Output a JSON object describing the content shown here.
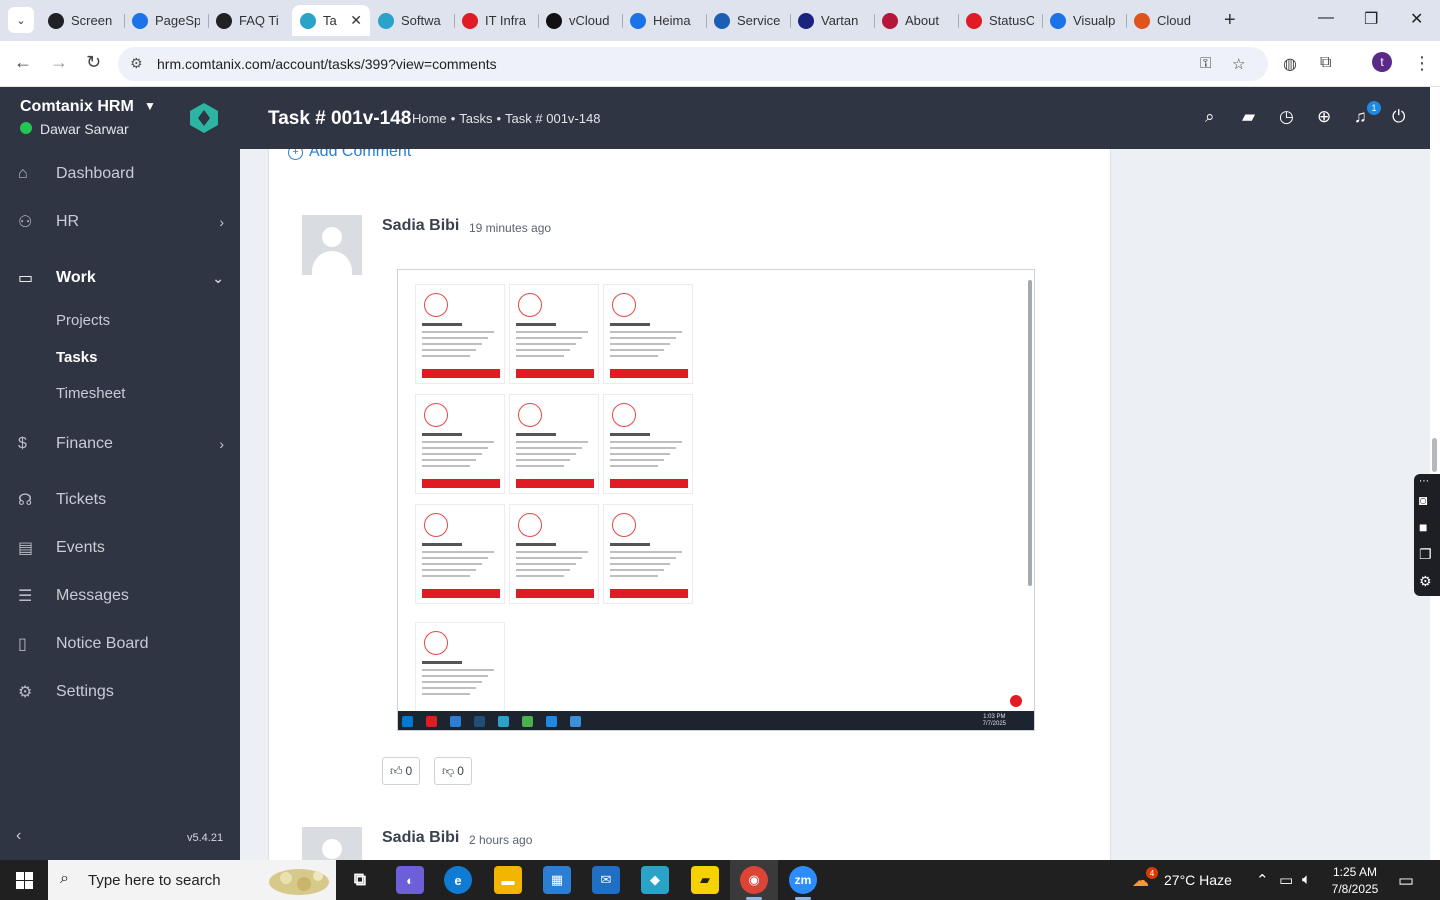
{
  "browser": {
    "tabs": [
      {
        "label": "Screen",
        "icon": "screen-recorder-icon",
        "color": "#202124"
      },
      {
        "label": "PageSp",
        "icon": "pagespeed-icon",
        "color": "#1a73e8"
      },
      {
        "label": "FAQ Ti",
        "icon": "faq-icon",
        "color": "#202124"
      },
      {
        "label": "Ta",
        "icon": "comtanix-icon",
        "color": "#2aa3c9",
        "active": true
      },
      {
        "label": "Softwa",
        "icon": "comtanix-icon",
        "color": "#2aa3c9"
      },
      {
        "label": "IT Infra",
        "icon": "it-infra-icon",
        "color": "#e01b24"
      },
      {
        "label": "vCloud",
        "icon": "vcloud-icon",
        "color": "#111111"
      },
      {
        "label": "Heima",
        "icon": "heima-icon",
        "color": "#1a73e8"
      },
      {
        "label": "Service",
        "icon": "service-icon",
        "color": "#1a5fb4"
      },
      {
        "label": "Vartan",
        "icon": "vartan-icon",
        "color": "#1a237e"
      },
      {
        "label": "About",
        "icon": "about-icon",
        "color": "#b5163a"
      },
      {
        "label": "StatusC",
        "icon": "status-icon",
        "color": "#e01b24"
      },
      {
        "label": "Visualp",
        "icon": "visualping-icon",
        "color": "#1a73e8"
      },
      {
        "label": "Cloud",
        "icon": "cloud-icon",
        "color": "#e0541b"
      }
    ],
    "url": "hrm.comtanix.com/account/tasks/399?view=comments",
    "profile_initial": "t"
  },
  "sidebar": {
    "brand": "Comtanix HRM",
    "user": "Dawar Sarwar",
    "items": [
      {
        "label": "Dashboard",
        "icon": "home-icon"
      },
      {
        "label": "HR",
        "icon": "users-icon",
        "chevron": "right"
      },
      {
        "label": "Work",
        "icon": "briefcase-icon",
        "chevron": "down",
        "active": true
      },
      {
        "label": "Finance",
        "icon": "dollar-icon",
        "chevron": "right"
      },
      {
        "label": "Tickets",
        "icon": "headset-icon"
      },
      {
        "label": "Events",
        "icon": "calendar-icon"
      },
      {
        "label": "Messages",
        "icon": "message-icon"
      },
      {
        "label": "Notice Board",
        "icon": "clipboard-icon"
      },
      {
        "label": "Settings",
        "icon": "gear-icon"
      }
    ],
    "work_sub": [
      "Projects",
      "Tasks",
      "Timesheet"
    ],
    "version": "v5.4.21"
  },
  "header": {
    "title": "Task # 001v-148",
    "breadcrumb": [
      "Home",
      "•",
      "Tasks",
      "•",
      "Task # 001v-148"
    ],
    "notification_count": "1"
  },
  "comments": {
    "add_label": "Add Comment",
    "list": [
      {
        "author": "Sadia Bibi",
        "time": "19 minutes ago",
        "likes": "0",
        "dislikes": "0"
      },
      {
        "author": "Sadia Bibi",
        "time": "2 hours ago"
      }
    ],
    "attachment": {
      "clock_time": "1:03 PM",
      "clock_date": "7/7/2025"
    }
  },
  "taskbar": {
    "search_placeholder": "Type here to search",
    "weather": "27°C  Haze",
    "weather_badge": "4",
    "time": "1:25 AM",
    "date": "7/8/2025"
  }
}
